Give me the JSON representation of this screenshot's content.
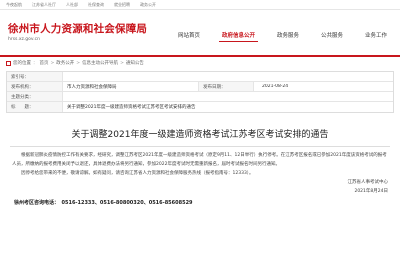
{
  "topbar": {
    "links": [
      "今夜起航",
      "江苏省人社厅",
      "人社部",
      "社保查询",
      "就业招聘",
      "政务公开"
    ]
  },
  "header": {
    "site_title": "徐州市人力资源和社会保障局",
    "domain": "hrss.xz.gov.cn"
  },
  "nav": {
    "items": [
      "网站首页",
      "政府信息公开",
      "政务服务",
      "公共服务",
      "业务工作"
    ],
    "active_index": 1
  },
  "breadcrumb": {
    "items": [
      "您的位置",
      "首页",
      "政务公开",
      "信息主动公开导航",
      "通知公告"
    ]
  },
  "meta": {
    "row1_label": "索引号：",
    "row1_value": "",
    "row2_label": "发布机构：",
    "row2_value": "市人力资源和社会保障局",
    "row2_date_label": "发布日期：",
    "row2_date_value": "2021-08-24",
    "row3_label": "主题分类：",
    "row3_value": "",
    "row4_label": "标　　题：",
    "row4_value": "关于调整2021年度一级建造师资格考试江苏考区考试安排的通告"
  },
  "article": {
    "title": "关于调整2021年度一级建造师资格考试江苏考区考试安排的通告",
    "paragraphs": [
      "根据新冠肺炎疫情防控工作有关要求，经研究，调整江苏考区2021年度一级建造师资格考试（原定9月11、12日举行）执行停考。在江苏考区报名或已参加2021年度该资格考试的报考人员，所缴纳的报考费用关闭予以退还，具体退费办法将另行通知，参加2022年度考试时无需重新报名，届时考试报名时间另行通知。",
      "因停考给您带来的不便，敬请谅解。如有疑问，请咨询江苏省人力资源和社会保障服务热线（报考指南号：12333）。"
    ],
    "signature_org": "江苏省人事考试中心",
    "signature_date": "2021年8月24日",
    "contact": "徐州考区咨询电话：　0516-12333、0516-80800320、0516-85608529"
  }
}
